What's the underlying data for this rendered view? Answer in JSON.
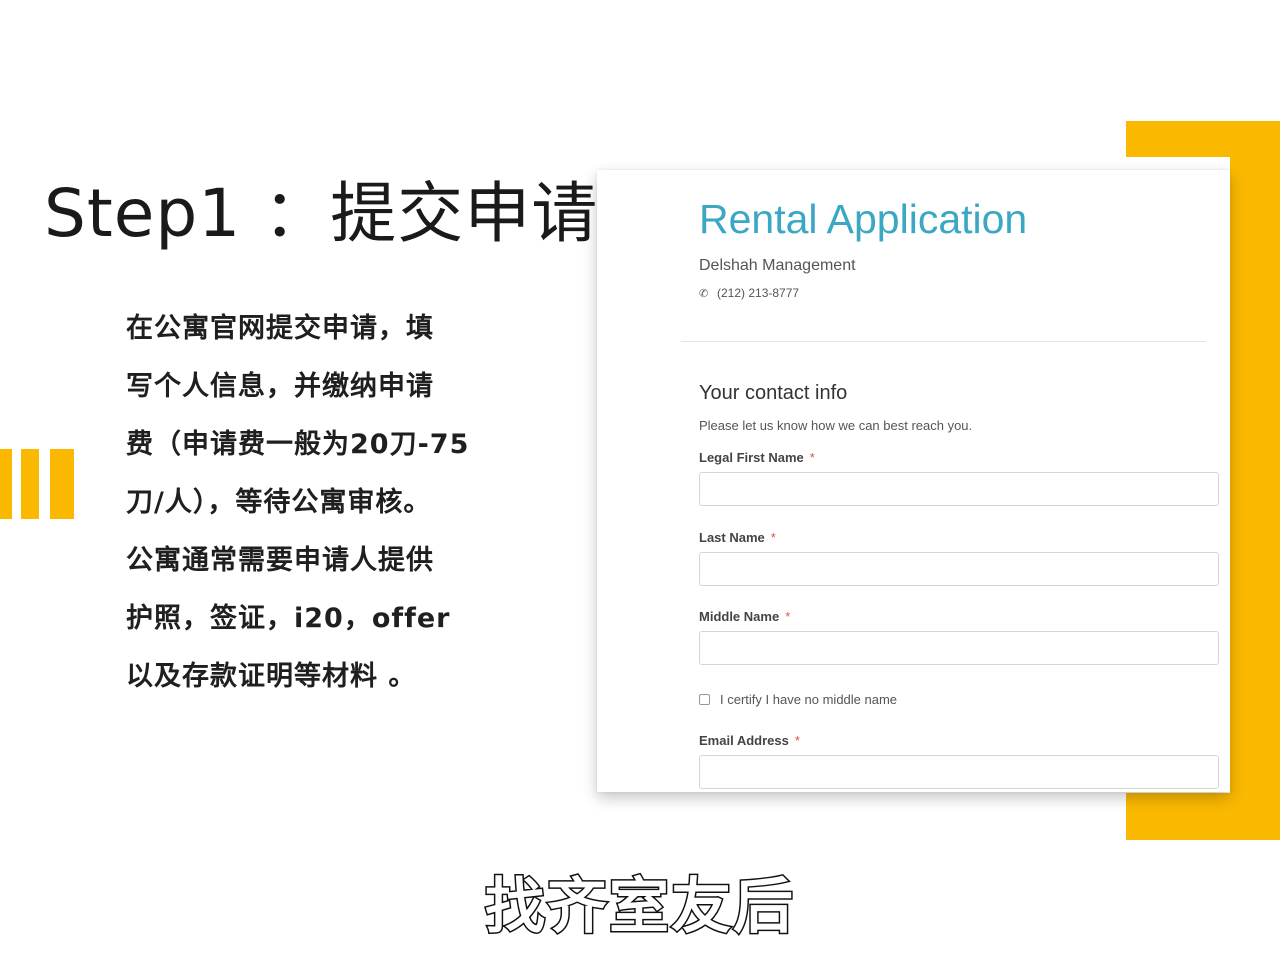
{
  "slide": {
    "title": "Step1 ：提交申请",
    "description_lines": [
      "在公寓官网提交申请，填",
      "写个人信息，并缴纳申请",
      "费（申请费一般为20刀-75",
      "刀/人），等待公寓审核。",
      "公寓通常需要申请人提供",
      "护照，签证，i20，offer",
      "以及存款证明等材料 。"
    ],
    "accent_color": "#fbb800"
  },
  "form": {
    "title": "Rental Application",
    "company": "Delshah Management",
    "phone": "(212) 213-8777",
    "phone_icon": "phone-icon",
    "section_title": "Your contact info",
    "section_subtitle": "Please let us know how we can best reach you.",
    "required_marker": "*",
    "fields": {
      "first_name": {
        "label": "Legal First Name",
        "value": ""
      },
      "last_name": {
        "label": "Last Name",
        "value": ""
      },
      "middle_name": {
        "label": "Middle Name",
        "value": ""
      },
      "email": {
        "label": "Email Address",
        "value": ""
      }
    },
    "no_middle_name_checkbox": {
      "label": "I certify I have no middle name",
      "checked": false
    },
    "title_color": "#3aa7c4"
  },
  "caption": "找齐室友后"
}
